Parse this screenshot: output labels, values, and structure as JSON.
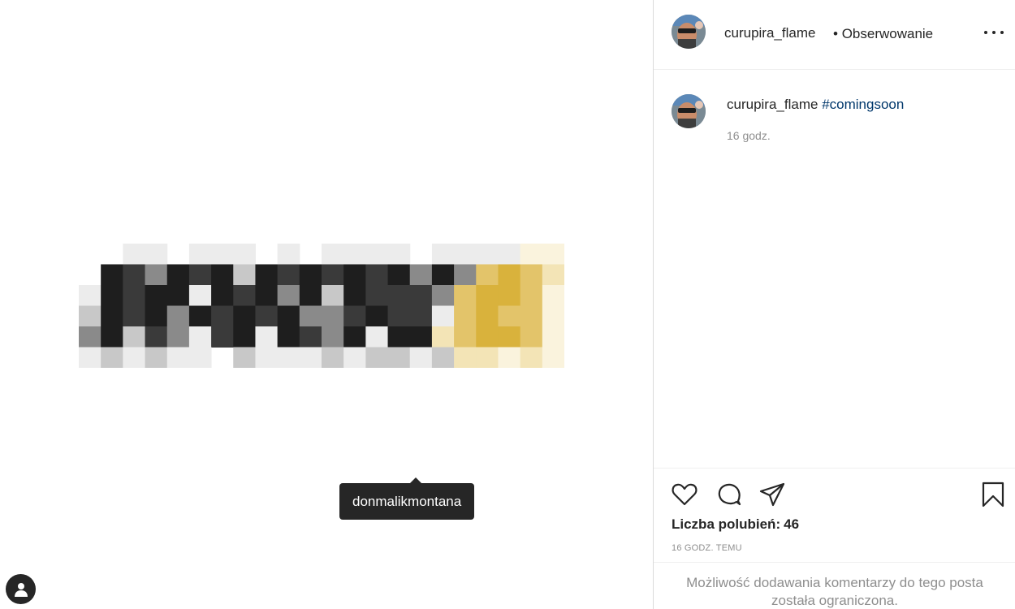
{
  "post": {
    "tagged_user": "donmalikmontana"
  },
  "header": {
    "username": "curupira_flame",
    "separator": "•",
    "follow_status": "Obserwowanie",
    "more_icon": "more-horizontal-icon"
  },
  "caption": {
    "username": "curupira_flame",
    "hashtag": "#comingsoon",
    "time": "16 godz."
  },
  "actions": {
    "like_icon": "heart-icon",
    "comment_icon": "comment-icon",
    "share_icon": "send-icon",
    "save_icon": "bookmark-icon"
  },
  "likes": {
    "label": "Liczba polubień:",
    "count": "46"
  },
  "post_age": "16 GODZ. TEMU",
  "comments_notice": {
    "line1": "Możliwość dodawania komentarzy do tego posta",
    "line2": "została ograniczona."
  },
  "colors": {
    "link": "#00376b",
    "muted": "#8e8e8e",
    "text": "#262626",
    "accent_yellow": "#d9b23c"
  }
}
